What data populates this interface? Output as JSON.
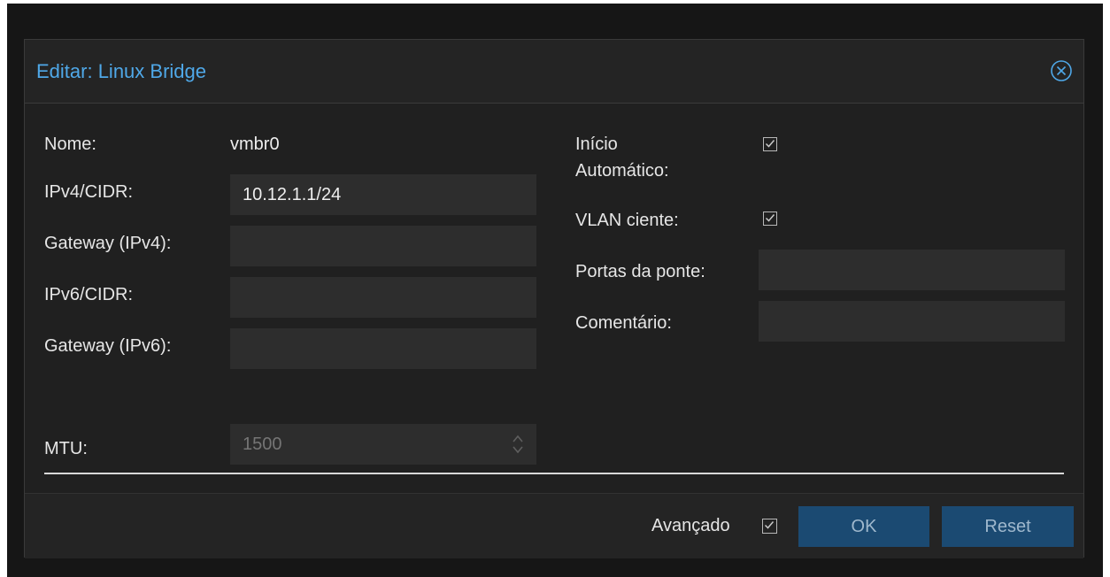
{
  "dialog": {
    "title": "Editar: Linux Bridge"
  },
  "form": {
    "left": {
      "name_label": "Nome:",
      "name_value": "vmbr0",
      "ipv4_label": "IPv4/CIDR:",
      "ipv4_value": "10.12.1.1/24",
      "gateway_ipv4_label": "Gateway (IPv4):",
      "gateway_ipv4_value": "",
      "ipv6_label": "IPv6/CIDR:",
      "ipv6_value": "",
      "gateway_ipv6_label": "Gateway (IPv6):",
      "gateway_ipv6_value": ""
    },
    "right": {
      "autostart_label_line1": "Início",
      "autostart_label_line2": "Automático:",
      "autostart_checked": true,
      "vlan_aware_label": "VLAN ciente:",
      "vlan_aware_checked": true,
      "bridge_ports_label": "Portas da ponte:",
      "bridge_ports_value": "",
      "comment_label": "Comentário:",
      "comment_value": ""
    },
    "advanced": {
      "mtu_label": "MTU:",
      "mtu_placeholder": "1500"
    }
  },
  "footer": {
    "advanced_label": "Avançado",
    "advanced_checked": true,
    "ok_label": "OK",
    "reset_label": "Reset"
  },
  "colors": {
    "title": "#4fa8e8",
    "primary_button": "#1b4a72",
    "background": "#202020",
    "field": "#2d2d2d"
  },
  "icons": {
    "close": "close-circle-icon",
    "checkbox": "checkmark-icon",
    "spinner": "spinner-arrows-icon"
  }
}
